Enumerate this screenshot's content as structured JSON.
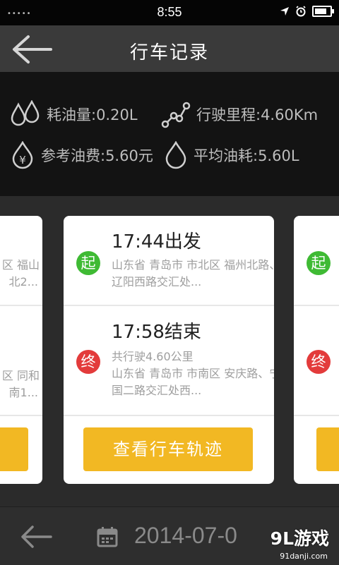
{
  "statusbar": {
    "time": "8:55",
    "dots": "•••••"
  },
  "header": {
    "title": "行车记录"
  },
  "stats": {
    "fuel": "耗油量:0.20L",
    "distance": "行驶里程:4.60Km",
    "cost": "参考油费:5.60元",
    "avg": "平均油耗:5.60L",
    "yen_symbol": "¥"
  },
  "card": {
    "start_time": "17:44出发",
    "start_badge": "起",
    "start_addr": "山东省 青岛市 市北区 福州北路、辽阳西路交汇处...",
    "end_time": "17:58结束",
    "end_badge": "终",
    "end_total": "共行驶4.60公里",
    "end_addr": "山东省 青岛市 市南区 安庆路、宁国二路交汇处西...",
    "track_button": "查看行车轨迹"
  },
  "left_card": {
    "line1": "区 福山",
    "line2": "北2...",
    "line3": "区 同和",
    "line4": "南1..."
  },
  "right_card": {
    "start_badge": "起",
    "end_badge": "终"
  },
  "bottombar": {
    "date": "2014-07-0"
  },
  "watermark": {
    "main": "9L游戏",
    "sub": "91danji.com"
  }
}
